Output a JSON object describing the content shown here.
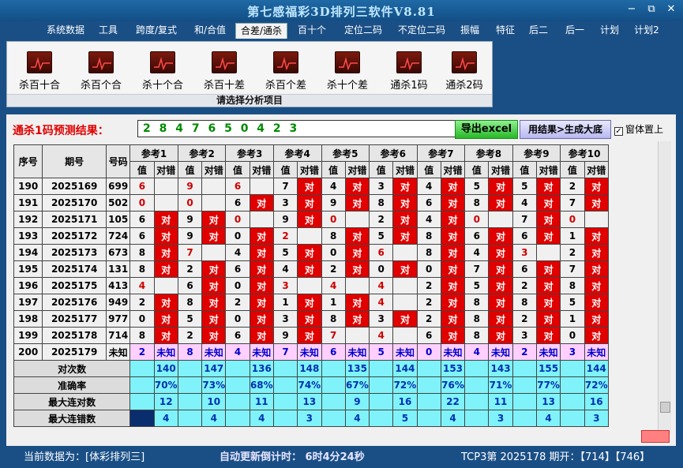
{
  "app": {
    "title": "第七感福彩3D排列三软件V8.81"
  },
  "window": {
    "minimize": "−",
    "restore": "⧉",
    "close": "✕"
  },
  "menu": [
    {
      "label": "系统数据",
      "active": false
    },
    {
      "label": "工具",
      "active": false
    },
    {
      "label": "跨度/复式",
      "active": false
    },
    {
      "label": "和/合值",
      "active": false
    },
    {
      "label": "合差/通杀",
      "active": true
    },
    {
      "label": "百十个",
      "active": false
    },
    {
      "label": "定位二码",
      "active": false
    },
    {
      "label": "不定位二码",
      "active": false
    },
    {
      "label": "振幅",
      "active": false
    },
    {
      "label": "特征",
      "active": false
    },
    {
      "label": "后二",
      "active": false
    },
    {
      "label": "后一",
      "active": false
    },
    {
      "label": "计划",
      "active": false
    },
    {
      "label": "计划2",
      "active": false
    }
  ],
  "ribbon": {
    "buttons": [
      "杀百十合",
      "杀百个合",
      "杀十个合",
      "杀百十差",
      "杀百个差",
      "杀十个差",
      "通杀1码",
      "通杀2码"
    ],
    "caption": "请选择分析项目"
  },
  "prediction": {
    "label": "通杀1码预测结果：",
    "value": "2 8 4 7 6 5 0 4 2 3",
    "export_btn": "导出excel",
    "gen_btn": "用结果>生成大底",
    "pin_label": "窗体置上",
    "pin_checked": true
  },
  "table": {
    "col_headers": [
      "序号",
      "期号",
      "号码"
    ],
    "ref_headers": [
      "参考1",
      "参考2",
      "参考3",
      "参考4",
      "参考5",
      "参考6",
      "参考7",
      "参考8",
      "参考9",
      "参考10"
    ],
    "sub_value": "值",
    "sub_hit": "对错",
    "hit_text": "对",
    "rows": [
      {
        "seq": "190",
        "period": "2025169",
        "code": "699",
        "refs": [
          [
            "6",
            "",
            1
          ],
          [
            "9",
            "",
            1
          ],
          [
            "6",
            "",
            1
          ],
          [
            "7",
            "对",
            0
          ],
          [
            "4",
            "对",
            0
          ],
          [
            "3",
            "对",
            0
          ],
          [
            "4",
            "对",
            0
          ],
          [
            "5",
            "对",
            0
          ],
          [
            "5",
            "对",
            0
          ],
          [
            "2",
            "对",
            0
          ]
        ]
      },
      {
        "seq": "191",
        "period": "2025170",
        "code": "502",
        "refs": [
          [
            "0",
            "",
            1
          ],
          [
            "0",
            "",
            1
          ],
          [
            "6",
            "对",
            0
          ],
          [
            "3",
            "对",
            0
          ],
          [
            "9",
            "对",
            0
          ],
          [
            "8",
            "对",
            0
          ],
          [
            "6",
            "对",
            0
          ],
          [
            "8",
            "对",
            0
          ],
          [
            "4",
            "对",
            0
          ],
          [
            "7",
            "对",
            0
          ]
        ]
      },
      {
        "seq": "192",
        "period": "2025171",
        "code": "105",
        "refs": [
          [
            "6",
            "对",
            0
          ],
          [
            "9",
            "对",
            0
          ],
          [
            "0",
            "",
            1
          ],
          [
            "9",
            "对",
            0
          ],
          [
            "0",
            "",
            1
          ],
          [
            "2",
            "对",
            0
          ],
          [
            "4",
            "对",
            0
          ],
          [
            "0",
            "",
            1
          ],
          [
            "7",
            "对",
            0
          ],
          [
            "0",
            "",
            1
          ]
        ]
      },
      {
        "seq": "193",
        "period": "2025172",
        "code": "724",
        "refs": [
          [
            "6",
            "对",
            0
          ],
          [
            "9",
            "对",
            0
          ],
          [
            "0",
            "对",
            0
          ],
          [
            "2",
            "",
            1
          ],
          [
            "8",
            "对",
            0
          ],
          [
            "5",
            "对",
            0
          ],
          [
            "8",
            "对",
            0
          ],
          [
            "6",
            "对",
            0
          ],
          [
            "6",
            "对",
            0
          ],
          [
            "1",
            "对",
            0
          ]
        ]
      },
      {
        "seq": "194",
        "period": "2025173",
        "code": "673",
        "refs": [
          [
            "8",
            "对",
            0
          ],
          [
            "7",
            "",
            1
          ],
          [
            "4",
            "对",
            0
          ],
          [
            "5",
            "对",
            0
          ],
          [
            "0",
            "对",
            0
          ],
          [
            "6",
            "",
            1
          ],
          [
            "8",
            "对",
            0
          ],
          [
            "4",
            "对",
            0
          ],
          [
            "3",
            "",
            1
          ],
          [
            "2",
            "对",
            0
          ]
        ]
      },
      {
        "seq": "195",
        "period": "2025174",
        "code": "131",
        "refs": [
          [
            "8",
            "对",
            0
          ],
          [
            "2",
            "对",
            0
          ],
          [
            "6",
            "对",
            0
          ],
          [
            "4",
            "对",
            0
          ],
          [
            "2",
            "对",
            0
          ],
          [
            "0",
            "对",
            0
          ],
          [
            "0",
            "对",
            0
          ],
          [
            "7",
            "对",
            0
          ],
          [
            "6",
            "对",
            0
          ],
          [
            "7",
            "对",
            0
          ]
        ]
      },
      {
        "seq": "196",
        "period": "2025175",
        "code": "413",
        "refs": [
          [
            "4",
            "",
            1
          ],
          [
            "6",
            "对",
            0
          ],
          [
            "0",
            "对",
            0
          ],
          [
            "3",
            "",
            1
          ],
          [
            "4",
            "",
            1
          ],
          [
            "4",
            "",
            1
          ],
          [
            "2",
            "对",
            0
          ],
          [
            "5",
            "对",
            0
          ],
          [
            "2",
            "对",
            0
          ],
          [
            "8",
            "对",
            0
          ]
        ]
      },
      {
        "seq": "197",
        "period": "2025176",
        "code": "949",
        "refs": [
          [
            "2",
            "对",
            0
          ],
          [
            "8",
            "对",
            0
          ],
          [
            "2",
            "对",
            0
          ],
          [
            "1",
            "对",
            0
          ],
          [
            "1",
            "对",
            0
          ],
          [
            "4",
            "",
            1
          ],
          [
            "2",
            "对",
            0
          ],
          [
            "8",
            "对",
            0
          ],
          [
            "8",
            "对",
            0
          ],
          [
            "5",
            "对",
            0
          ]
        ]
      },
      {
        "seq": "198",
        "period": "2025177",
        "code": "977",
        "refs": [
          [
            "0",
            "对",
            0
          ],
          [
            "5",
            "对",
            0
          ],
          [
            "0",
            "对",
            0
          ],
          [
            "3",
            "对",
            0
          ],
          [
            "8",
            "对",
            0
          ],
          [
            "3",
            "对",
            0
          ],
          [
            "2",
            "对",
            0
          ],
          [
            "8",
            "对",
            0
          ],
          [
            "2",
            "对",
            0
          ],
          [
            "1",
            "对",
            0
          ]
        ]
      },
      {
        "seq": "199",
        "period": "2025178",
        "code": "714",
        "refs": [
          [
            "8",
            "对",
            0
          ],
          [
            "2",
            "对",
            0
          ],
          [
            "6",
            "对",
            0
          ],
          [
            "9",
            "对",
            0
          ],
          [
            "7",
            "",
            1
          ],
          [
            "4",
            "",
            1
          ],
          [
            "6",
            "对",
            0
          ],
          [
            "8",
            "对",
            0
          ],
          [
            "3",
            "对",
            0
          ],
          [
            "0",
            "对",
            0
          ]
        ]
      },
      {
        "seq": "200",
        "period": "2025179",
        "code": "未知",
        "refs": [
          [
            "2",
            "未知",
            2
          ],
          [
            "8",
            "未知",
            2
          ],
          [
            "4",
            "未知",
            2
          ],
          [
            "7",
            "未知",
            2
          ],
          [
            "6",
            "未知",
            2
          ],
          [
            "5",
            "未知",
            2
          ],
          [
            "0",
            "未知",
            2
          ],
          [
            "4",
            "未知",
            2
          ],
          [
            "2",
            "未知",
            2
          ],
          [
            "3",
            "未知",
            2
          ]
        ]
      }
    ],
    "stats": [
      {
        "label": "对次数",
        "values": [
          "140",
          "147",
          "136",
          "148",
          "135",
          "144",
          "153",
          "143",
          "155",
          "144"
        ]
      },
      {
        "label": "准确率",
        "values": [
          "70%",
          "73%",
          "68%",
          "74%",
          "67%",
          "72%",
          "76%",
          "71%",
          "77%",
          "72%"
        ]
      },
      {
        "label": "最大连对数",
        "values": [
          "12",
          "10",
          "11",
          "13",
          "9",
          "16",
          "22",
          "11",
          "13",
          "16"
        ]
      },
      {
        "label": "最大连错数",
        "values": [
          "4",
          "4",
          "4",
          "3",
          "4",
          "5",
          "4",
          "3",
          "4",
          "3"
        ]
      }
    ]
  },
  "status": {
    "current_data": "当前数据为：[体彩排列三]",
    "countdown": "自动更新倒计时： 6时4分24秒",
    "draw": "TCP3第 2025178 期开：【714】【746】"
  }
}
